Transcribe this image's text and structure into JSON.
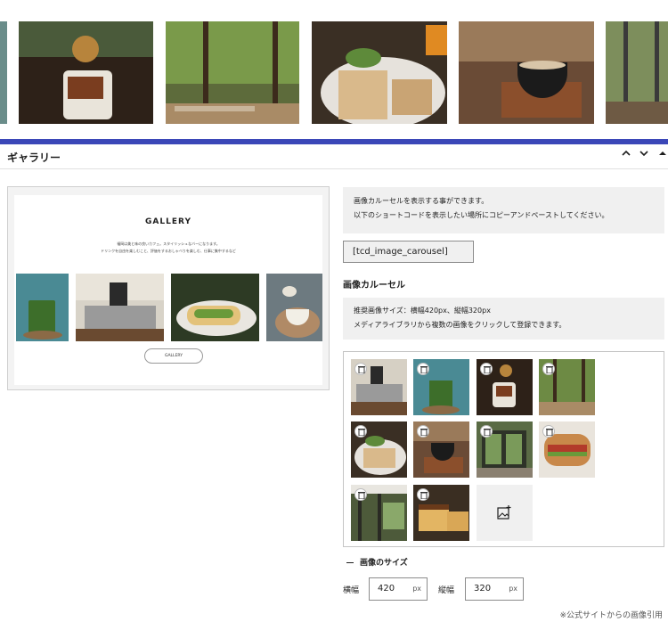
{
  "panel": {
    "title": "ギャラリー",
    "controls": [
      "⌃",
      "⌄",
      "▲"
    ]
  },
  "preview": {
    "title": "GALLERY",
    "line1": "福岡は美と味の良いカフェ。スタイリッシュなバーになります。",
    "line2": "ドリンクを自由を楽しむこと、評価をするおしゃべりを楽しむ、仕事に集中するなど",
    "button": "GALLERY"
  },
  "info": {
    "line1": "画像カルーセルを表示する事ができます。",
    "line2": "以下のショートコードを表示したい場所にコピーアンドペーストしてください。"
  },
  "shortcode": "[tcd_image_carousel]",
  "carousel": {
    "heading": "画像カルーセル",
    "note1": "推奨画像サイズ：横幅420px、縦幅320px",
    "note2": "メディアライブラリから複数の画像をクリックして登録できます。"
  },
  "size": {
    "heading": "画像のサイズ",
    "width_label": "横幅",
    "width_value": "420",
    "height_label": "縦幅",
    "height_value": "320",
    "unit": "px"
  },
  "credit": "※公式サイトからの画像引用"
}
